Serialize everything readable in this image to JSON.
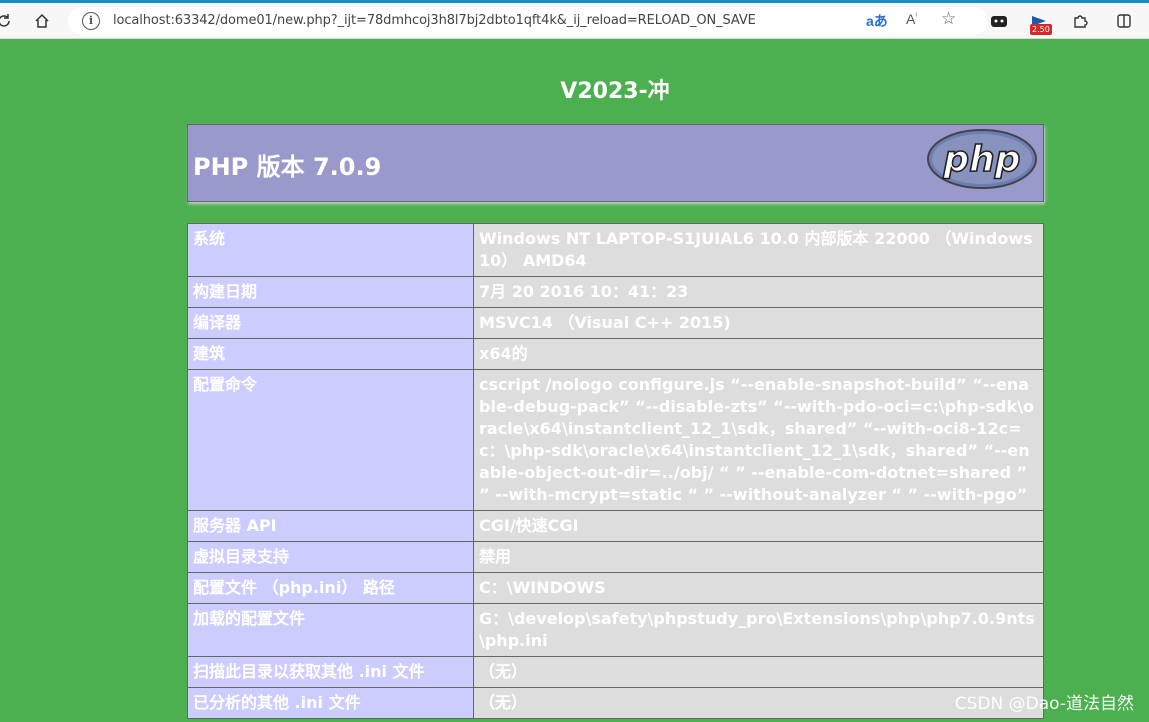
{
  "browser": {
    "url": "localhost:63342/dome01/new.php?_ijt=78dmhcoj3h8l7bj2dbto1qft4k&_ij_reload=RELOAD_ON_SAVE",
    "badge": "2.50",
    "icons": [
      "reload-icon",
      "home-icon",
      "info-icon",
      "translate-icon",
      "read-aloud-icon",
      "favorite-star-icon",
      "extension-game-icon",
      "extension-badge-icon",
      "extensions-puzzle-icon",
      "split-screen-icon"
    ]
  },
  "page": {
    "title": "V2023-冲",
    "php_header": "PHP 版本 7.0.9",
    "logo_text": "php"
  },
  "rows": [
    {
      "key": "系统",
      "value": "Windows NT LAPTOP-S1JUIAL6 10.0 内部版本 22000 （Windows 10） AMD64"
    },
    {
      "key": "构建日期",
      "value": "7月 20 2016 10：41：23"
    },
    {
      "key": "编译器",
      "value": "MSVC14 （Visual C++ 2015)"
    },
    {
      "key": "建筑",
      "value": "x64的"
    },
    {
      "key": "配置命令",
      "value": "cscript /nologo configure.js “--enable-snapshot-build” “--enable-debug-pack” “--disable-zts” “--with-pdo-oci=c:\\php-sdk\\oracle\\x64\\instantclient_12_1\\sdk，shared” “--with-oci8-12c=c：\\php-sdk\\oracle\\x64\\instantclient_12_1\\sdk，shared” “--enable-object-out-dir=../obj/ “ ” --enable-com-dotnet=shared ” ” --with-mcrypt=static “ ” --without-analyzer “ ” --with-pgo”"
    },
    {
      "key": "服务器 API",
      "value": "CGI/快速CGI"
    },
    {
      "key": "虚拟目录支持",
      "value": "禁用"
    },
    {
      "key": "配置文件 （php.ini） 路径",
      "value": "C：\\WINDOWS"
    },
    {
      "key": "加载的配置文件",
      "value": "G：\\develop\\safety\\phpstudy_pro\\Extensions\\php\\php7.0.9nts\\php.ini"
    },
    {
      "key": "扫描此目录以获取其他 .ini 文件",
      "value": "（无）"
    },
    {
      "key": "已分析的其他 .ini 文件",
      "value": "（无）"
    }
  ],
  "watermark": "CSDN @Dao-道法自然"
}
